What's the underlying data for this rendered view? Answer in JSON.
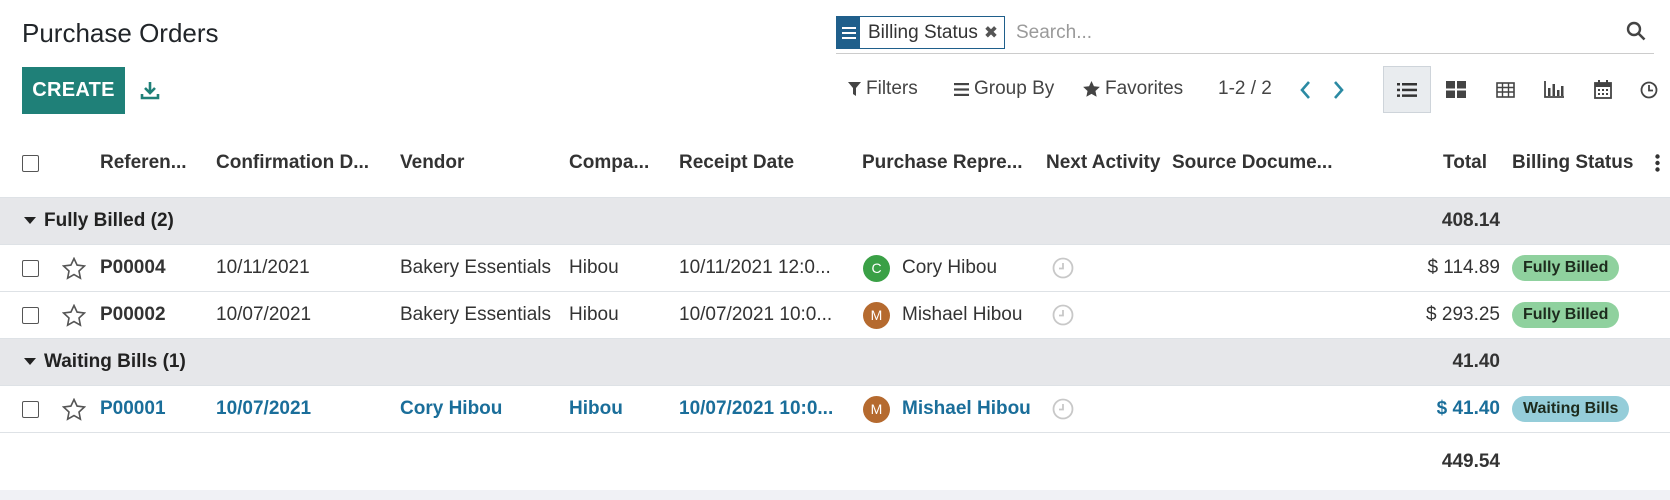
{
  "page": {
    "title": "Purchase Orders"
  },
  "toolbar": {
    "create_label": "CREATE"
  },
  "search": {
    "facet_label": "Billing Status",
    "facet_remove": "✖",
    "placeholder": "Search..."
  },
  "controls": {
    "filters": "Filters",
    "group_by": "Group By",
    "favorites": "Favorites",
    "pager": "1-2 / 2"
  },
  "columns": [
    "Referen...",
    "Confirmation D...",
    "Vendor",
    "Compa...",
    "Receipt Date",
    "Purchase Repre...",
    "Next Activity",
    "Source Docume...",
    "Total",
    "Billing Status"
  ],
  "groups": [
    {
      "label": "Fully Billed (2)",
      "total": "408.14",
      "rows": [
        {
          "reference": "P00004",
          "confirmation_date": "10/11/2021",
          "vendor": "Bakery Essentials",
          "company": "Hibou",
          "receipt_date": "10/11/2021 12:0...",
          "rep_initial": "C",
          "rep_color": "#3aa046",
          "rep": "Cory Hibou",
          "source": "",
          "total": "$ 114.89",
          "status": "Fully Billed",
          "status_color": "#8fd19e"
        },
        {
          "reference": "P00002",
          "confirmation_date": "10/07/2021",
          "vendor": "Bakery Essentials",
          "company": "Hibou",
          "receipt_date": "10/07/2021 10:0...",
          "rep_initial": "M",
          "rep_color": "#b56a2f",
          "rep": "Mishael Hibou",
          "source": "",
          "total": "$ 293.25",
          "status": "Fully Billed",
          "status_color": "#8fd19e"
        }
      ]
    },
    {
      "label": "Waiting Bills (1)",
      "total": "41.40",
      "rows": [
        {
          "reference": "P00001",
          "confirmation_date": "10/07/2021",
          "vendor": "Cory Hibou",
          "company": "Hibou",
          "receipt_date": "10/07/2021 10:0...",
          "rep_initial": "M",
          "rep_color": "#b56a2f",
          "rep": "Mishael Hibou",
          "source": "",
          "total": "$ 41.40",
          "status": "Waiting Bills",
          "status_color": "#95cdd9"
        }
      ]
    }
  ],
  "grand_total": "449.54",
  "colors": {
    "accent": "#1f8078",
    "facet": "#1f5f8b",
    "link": "#1a6e9a",
    "pager_arrow": "#2b8aa3"
  },
  "icons": [
    "download-icon",
    "hamburger-icon",
    "search-icon",
    "filter-icon",
    "group-by-icon",
    "star-icon",
    "chevron-left-icon",
    "chevron-right-icon",
    "list-view-icon",
    "kanban-view-icon",
    "pivot-view-icon",
    "graph-view-icon",
    "calendar-view-icon",
    "activity-view-icon",
    "clock-icon",
    "kebab-icon",
    "caret-down-icon"
  ]
}
